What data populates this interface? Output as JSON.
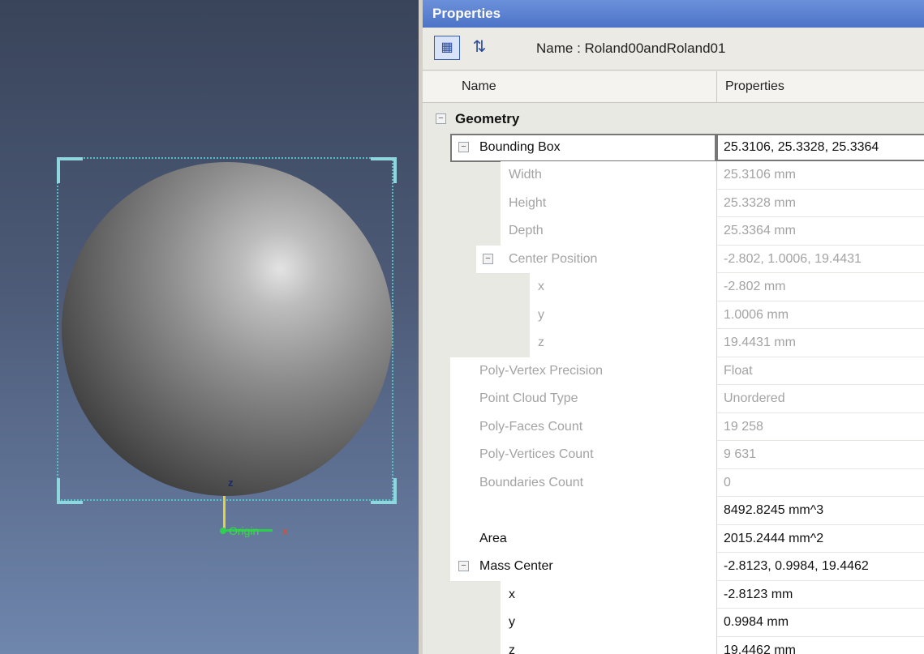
{
  "viewport": {
    "axis_z_label": "z",
    "origin_label": "Origin",
    "axis_x_label": "x"
  },
  "panel": {
    "title": "Properties",
    "name_label": "Name : Roland00andRoland01",
    "columns": {
      "name": "Name",
      "properties": "Properties"
    },
    "category": "Geometry",
    "rows": [
      {
        "name": "Bounding Box",
        "value": "25.3106, 25.3328, 25.3364"
      },
      {
        "name": "Width",
        "value": "25.3106 mm"
      },
      {
        "name": "Height",
        "value": "25.3328 mm"
      },
      {
        "name": "Depth",
        "value": "25.3364 mm"
      },
      {
        "name": "Center Position",
        "value": "-2.802, 1.0006, 19.4431"
      },
      {
        "name": "x",
        "value": "-2.802 mm"
      },
      {
        "name": "y",
        "value": "1.0006 mm"
      },
      {
        "name": "z",
        "value": "19.4431 mm"
      },
      {
        "name": "Poly-Vertex Precision",
        "value": "Float"
      },
      {
        "name": "Point Cloud Type",
        "value": "Unordered"
      },
      {
        "name": "Poly-Faces Count",
        "value": "19 258"
      },
      {
        "name": "Poly-Vertices Count",
        "value": "9 631"
      },
      {
        "name": "Boundaries Count",
        "value": "0"
      },
      {
        "name": "",
        "value": "8492.8245 mm^3"
      },
      {
        "name": "Area",
        "value": "2015.2444 mm^2"
      },
      {
        "name": "Mass Center",
        "value": "-2.8123, 0.9984, 19.4462"
      },
      {
        "name": "x",
        "value": "-2.8123 mm"
      },
      {
        "name": "y",
        "value": "0.9984 mm"
      },
      {
        "name": "z",
        "value": "19.4462 mm"
      }
    ]
  }
}
